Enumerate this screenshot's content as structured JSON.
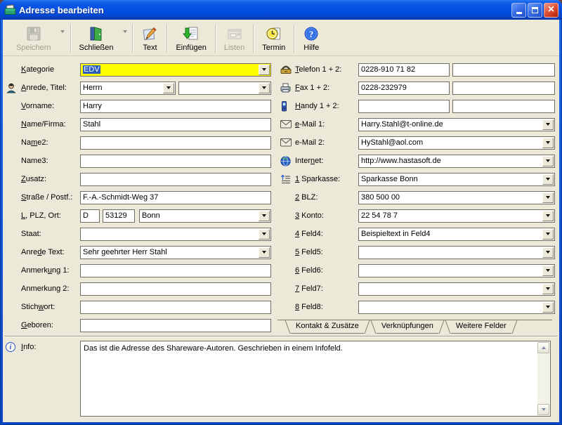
{
  "window": {
    "title": "Adresse bearbeiten",
    "icon": "address-book-icon"
  },
  "toolbar": {
    "buttons": [
      {
        "key": "speichern",
        "label": "Speichern",
        "icon": "save-icon",
        "disabled": true,
        "caret": true
      },
      {
        "key": "schliessen",
        "label": "Schließen",
        "icon": "door-icon",
        "disabled": false,
        "caret": true
      },
      {
        "key": "text",
        "label": "Text",
        "icon": "pencil-icon",
        "disabled": false,
        "caret": false
      },
      {
        "key": "einfuegen",
        "label": "Einfügen",
        "icon": "paste-icon",
        "disabled": false,
        "caret": false
      },
      {
        "key": "listen",
        "label": "Listen",
        "icon": "lists-icon",
        "disabled": true,
        "caret": false
      },
      {
        "key": "termin",
        "label": "Termin",
        "icon": "clock-icon",
        "disabled": false,
        "caret": false
      },
      {
        "key": "hilfe",
        "label": "Hilfe",
        "icon": "help-icon",
        "disabled": false,
        "caret": false
      }
    ]
  },
  "form": {
    "left": [
      {
        "key": "kategorie",
        "label": "Kategorie",
        "accel": 0,
        "type": "combo",
        "value": "EDV",
        "yellow": true,
        "selected": true
      },
      {
        "key": "anrede",
        "label": "Anrede, Titel:",
        "accel": 0,
        "icon": "person-icon",
        "type": "combo2",
        "values": [
          "Herrn",
          ""
        ]
      },
      {
        "key": "vorname",
        "label": "Vorname:",
        "accel": 0,
        "type": "input",
        "value": "Harry"
      },
      {
        "key": "name-firma",
        "label": "Name/Firma:",
        "accel": 0,
        "type": "input",
        "value": "Stahl"
      },
      {
        "key": "name2",
        "label": "Name2:",
        "accel": 2,
        "type": "input",
        "value": ""
      },
      {
        "key": "name3",
        "label": "Name3:",
        "accel": -1,
        "type": "input",
        "value": ""
      },
      {
        "key": "zusatz",
        "label": "Zusatz:",
        "accel": 0,
        "type": "input",
        "value": ""
      },
      {
        "key": "strasse",
        "label": "Straße / Postf.:",
        "accel": 0,
        "type": "input",
        "value": "F.-A.-Schmidt-Weg 37"
      },
      {
        "key": "plz-ort",
        "label": "L, PLZ, Ort:",
        "accel": 0,
        "type": "plz",
        "values": [
          "D",
          "53129",
          "Bonn"
        ]
      },
      {
        "key": "staat",
        "label": "Staat:",
        "accel": -1,
        "type": "combo",
        "value": ""
      },
      {
        "key": "anrede-text",
        "label": "Anrede Text:",
        "accel": 4,
        "type": "combo",
        "value": "Sehr geehrter Herr Stahl"
      },
      {
        "key": "anmerkung1",
        "label": "Anmerkung 1:",
        "accel": 6,
        "type": "input",
        "value": ""
      },
      {
        "key": "anmerkung2",
        "label": "Anmerkung 2:",
        "accel": -1,
        "type": "input",
        "value": ""
      },
      {
        "key": "stichwort",
        "label": "Stichwort:",
        "accel": 5,
        "type": "input",
        "value": ""
      },
      {
        "key": "geboren",
        "label": "Geboren:",
        "accel": 0,
        "type": "input",
        "value": ""
      }
    ],
    "right": [
      {
        "key": "telefon",
        "label": "Telefon 1 + 2:",
        "accel": 0,
        "icon": "phone-icon",
        "type": "input2",
        "values": [
          "0228-910 71 82",
          ""
        ]
      },
      {
        "key": "fax",
        "label": "Fax 1 + 2:",
        "accel": 0,
        "icon": "fax-icon",
        "type": "input2",
        "values": [
          "0228-232979",
          ""
        ]
      },
      {
        "key": "handy",
        "label": "Handy 1 + 2:",
        "accel": 0,
        "icon": "mobile-icon",
        "type": "input2",
        "values": [
          "",
          ""
        ]
      },
      {
        "key": "email1",
        "label": "e-Mail 1:",
        "accel": 0,
        "icon": "mail-icon",
        "type": "combo",
        "value": "Harry.Stahl@t-online.de"
      },
      {
        "key": "email2",
        "label": "e-Mail 2:",
        "accel": -1,
        "icon": "mail-icon",
        "type": "combo",
        "value": "HyStahl@aol.com"
      },
      {
        "key": "internet",
        "label": "Internet:",
        "accel": 5,
        "icon": "globe-icon",
        "type": "combo",
        "value": "http://www.hastasoft.de"
      },
      {
        "key": "sparkasse",
        "label": "1 Sparkasse:",
        "accel": 0,
        "icon": "list-icon",
        "type": "combo",
        "value": "Sparkasse Bonn"
      },
      {
        "key": "blz",
        "label": "2 BLZ:",
        "accel": 0,
        "type": "combo",
        "value": "380 500 00"
      },
      {
        "key": "konto",
        "label": "3 Konto:",
        "accel": 0,
        "type": "combo",
        "value": "22 54 78 7"
      },
      {
        "key": "feld4",
        "label": "4 Feld4:",
        "accel": 0,
        "type": "combo",
        "value": "Beispieltext in Feld4"
      },
      {
        "key": "feld5",
        "label": "5 Feld5:",
        "accel": 0,
        "type": "combo",
        "value": ""
      },
      {
        "key": "feld6",
        "label": "6 Feld6:",
        "accel": 0,
        "type": "combo",
        "value": ""
      },
      {
        "key": "feld7",
        "label": "7 Feld7:",
        "accel": 0,
        "type": "combo",
        "value": ""
      },
      {
        "key": "feld8",
        "label": "8 Feld8:",
        "accel": 0,
        "type": "combo",
        "value": ""
      }
    ]
  },
  "tabs": {
    "active": 0,
    "items": [
      {
        "key": "kontakt-zusaetze",
        "label": "Kontakt & Zusätze"
      },
      {
        "key": "verknuepfungen",
        "label": "Verknüpfungen"
      },
      {
        "key": "weitere-felder",
        "label": "Weitere Felder"
      }
    ]
  },
  "info": {
    "label": "Info:",
    "accel": 0,
    "icon": "info-icon",
    "text": "Das ist die Adresse des Shareware-Autoren. Geschrieben in einem Infofeld."
  },
  "colors": {
    "dialog_bg": "#ECE9D8",
    "titlebar_blue": "#0550E2",
    "field_focus_yellow": "#FFFF00",
    "selection_blue": "#2B5DBE"
  }
}
